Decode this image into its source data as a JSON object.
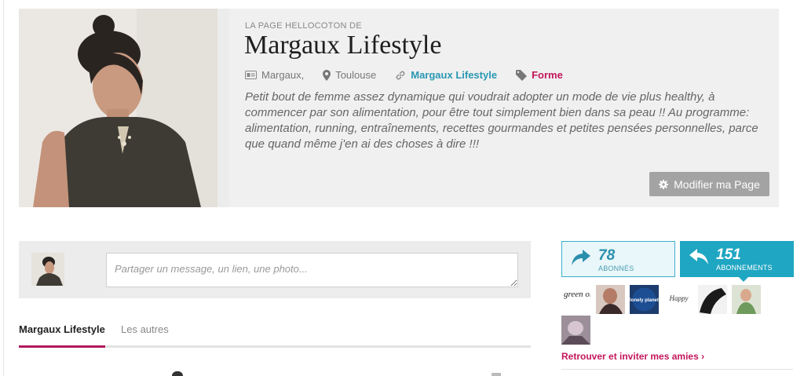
{
  "profile": {
    "kicker": "LA PAGE HELLOCOTON DE",
    "title": "Margaux Lifestyle",
    "meta": {
      "name": "Margaux,",
      "city": "Toulouse",
      "blog": "Margaux Lifestyle",
      "tag": "Forme"
    },
    "description": "Petit bout de femme assez dynamique qui voudrait adopter un mode de vie plus healthy, à commencer par son alimentation, pour être tout simplement bien dans sa peau !! Au programme: alimentation, running, entraînements, recettes gourmandes et petites pensées personnelles, parce que quand même j'en ai des choses à dire !!!",
    "edit_button": "Modifier ma Page"
  },
  "composer": {
    "placeholder": "Partager un message, un lien, une photo..."
  },
  "tabs": [
    {
      "label": "Margaux Lifestyle",
      "active": true
    },
    {
      "label": "Les autres",
      "active": false
    }
  ],
  "stats": {
    "followers": {
      "count": "78",
      "label": "ABONNÉS"
    },
    "following": {
      "count": "151",
      "label": "ABONNEMENTS"
    }
  },
  "follower_thumbs": [
    {
      "text": "green ola"
    },
    {
      "text": ""
    },
    {
      "text": "lonely planet"
    },
    {
      "text": "Happy"
    },
    {
      "text": ""
    },
    {
      "text": ""
    },
    {
      "text": ""
    }
  ],
  "invite_link": "Retrouver et inviter mes amies ›",
  "colors": {
    "accent_blue": "#1fa6c2",
    "accent_pink": "#c3175a",
    "button_gray": "#a3a3a3"
  }
}
